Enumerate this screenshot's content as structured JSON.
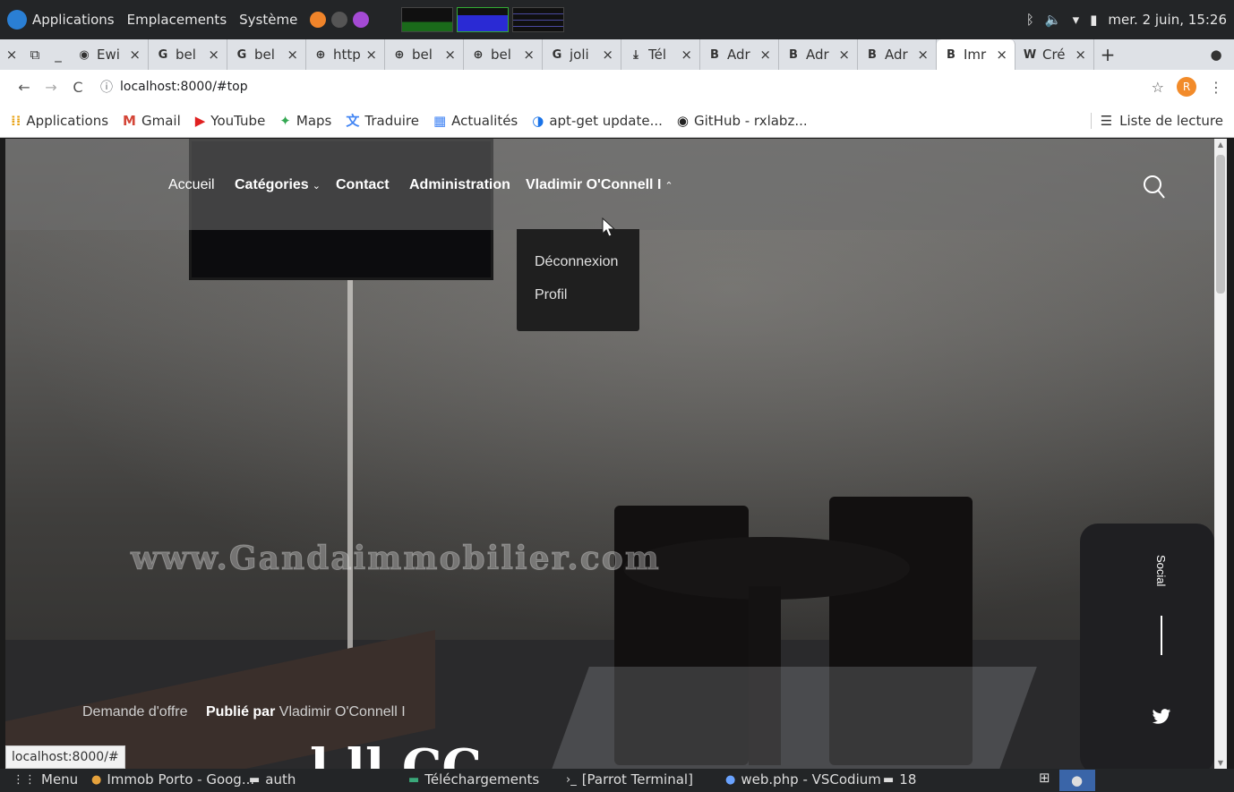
{
  "os_panel": {
    "menu_apps": "Applications",
    "menu_places": "Emplacements",
    "menu_system": "Système",
    "clock": "mer. 2 juin, 15:26"
  },
  "tabs": [
    {
      "icon": "github-icon",
      "label": "Ewi"
    },
    {
      "icon": "google-icon",
      "label": "bel"
    },
    {
      "icon": "google-icon",
      "label": "bel"
    },
    {
      "icon": "globe-icon",
      "label": "http"
    },
    {
      "icon": "globe-icon",
      "label": "bel"
    },
    {
      "icon": "globe-icon",
      "label": "bel"
    },
    {
      "icon": "google-icon",
      "label": "joli"
    },
    {
      "icon": "download-icon",
      "label": "Tél"
    },
    {
      "icon": "bootstrap-icon",
      "label": "Adr"
    },
    {
      "icon": "bootstrap-icon",
      "label": "Adr"
    },
    {
      "icon": "bootstrap-icon",
      "label": "Adr"
    },
    {
      "icon": "bootstrap-icon",
      "label": "Imr",
      "active": true
    },
    {
      "icon": "wordpress-icon",
      "label": "Cré"
    }
  ],
  "address": {
    "url": "localhost:8000/#top",
    "avatar_letter": "R"
  },
  "bookmarks": [
    {
      "icon": "apps-grid-icon",
      "label": "Applications"
    },
    {
      "icon": "gmail-icon",
      "label": "Gmail"
    },
    {
      "icon": "youtube-icon",
      "label": "YouTube"
    },
    {
      "icon": "maps-icon",
      "label": "Maps"
    },
    {
      "icon": "translate-icon",
      "label": "Traduire"
    },
    {
      "icon": "news-icon",
      "label": "Actualités"
    },
    {
      "icon": "debian-icon",
      "label": "apt-get update..."
    },
    {
      "icon": "github-icon",
      "label": "GitHub - rxlabz..."
    }
  ],
  "reading_list": "Liste de lecture",
  "site": {
    "nav": {
      "home": "Accueil",
      "categories": "Catégories",
      "contact": "Contact",
      "admin": "Administration",
      "user": "Vladimir O'Connell I"
    },
    "dropdown": [
      "Déconnexion",
      "Profil"
    ],
    "watermark": "www.Gandaimmobilier.com",
    "social": "Social",
    "meta": {
      "category": "Demande d'offre",
      "published_by": "Publié par",
      "author": "Vladimir O'Connell I"
    },
    "title_partial": "l  ll  CC"
  },
  "status_url": "localhost:8000/#",
  "taskbar": [
    {
      "icon": "menu-grid-icon",
      "label": "Menu"
    },
    {
      "icon": "chrome-icon",
      "label": "Immob Porto - Goog..."
    },
    {
      "icon": "folder-icon",
      "label": "auth"
    },
    {
      "icon": "downloads-icon",
      "label": "Téléchargements"
    },
    {
      "icon": "terminal-icon",
      "label": "[Parrot Terminal]"
    },
    {
      "icon": "vscodium-icon",
      "label": "web.php - VSCodium"
    },
    {
      "icon": "folder-icon",
      "label": "18"
    }
  ]
}
